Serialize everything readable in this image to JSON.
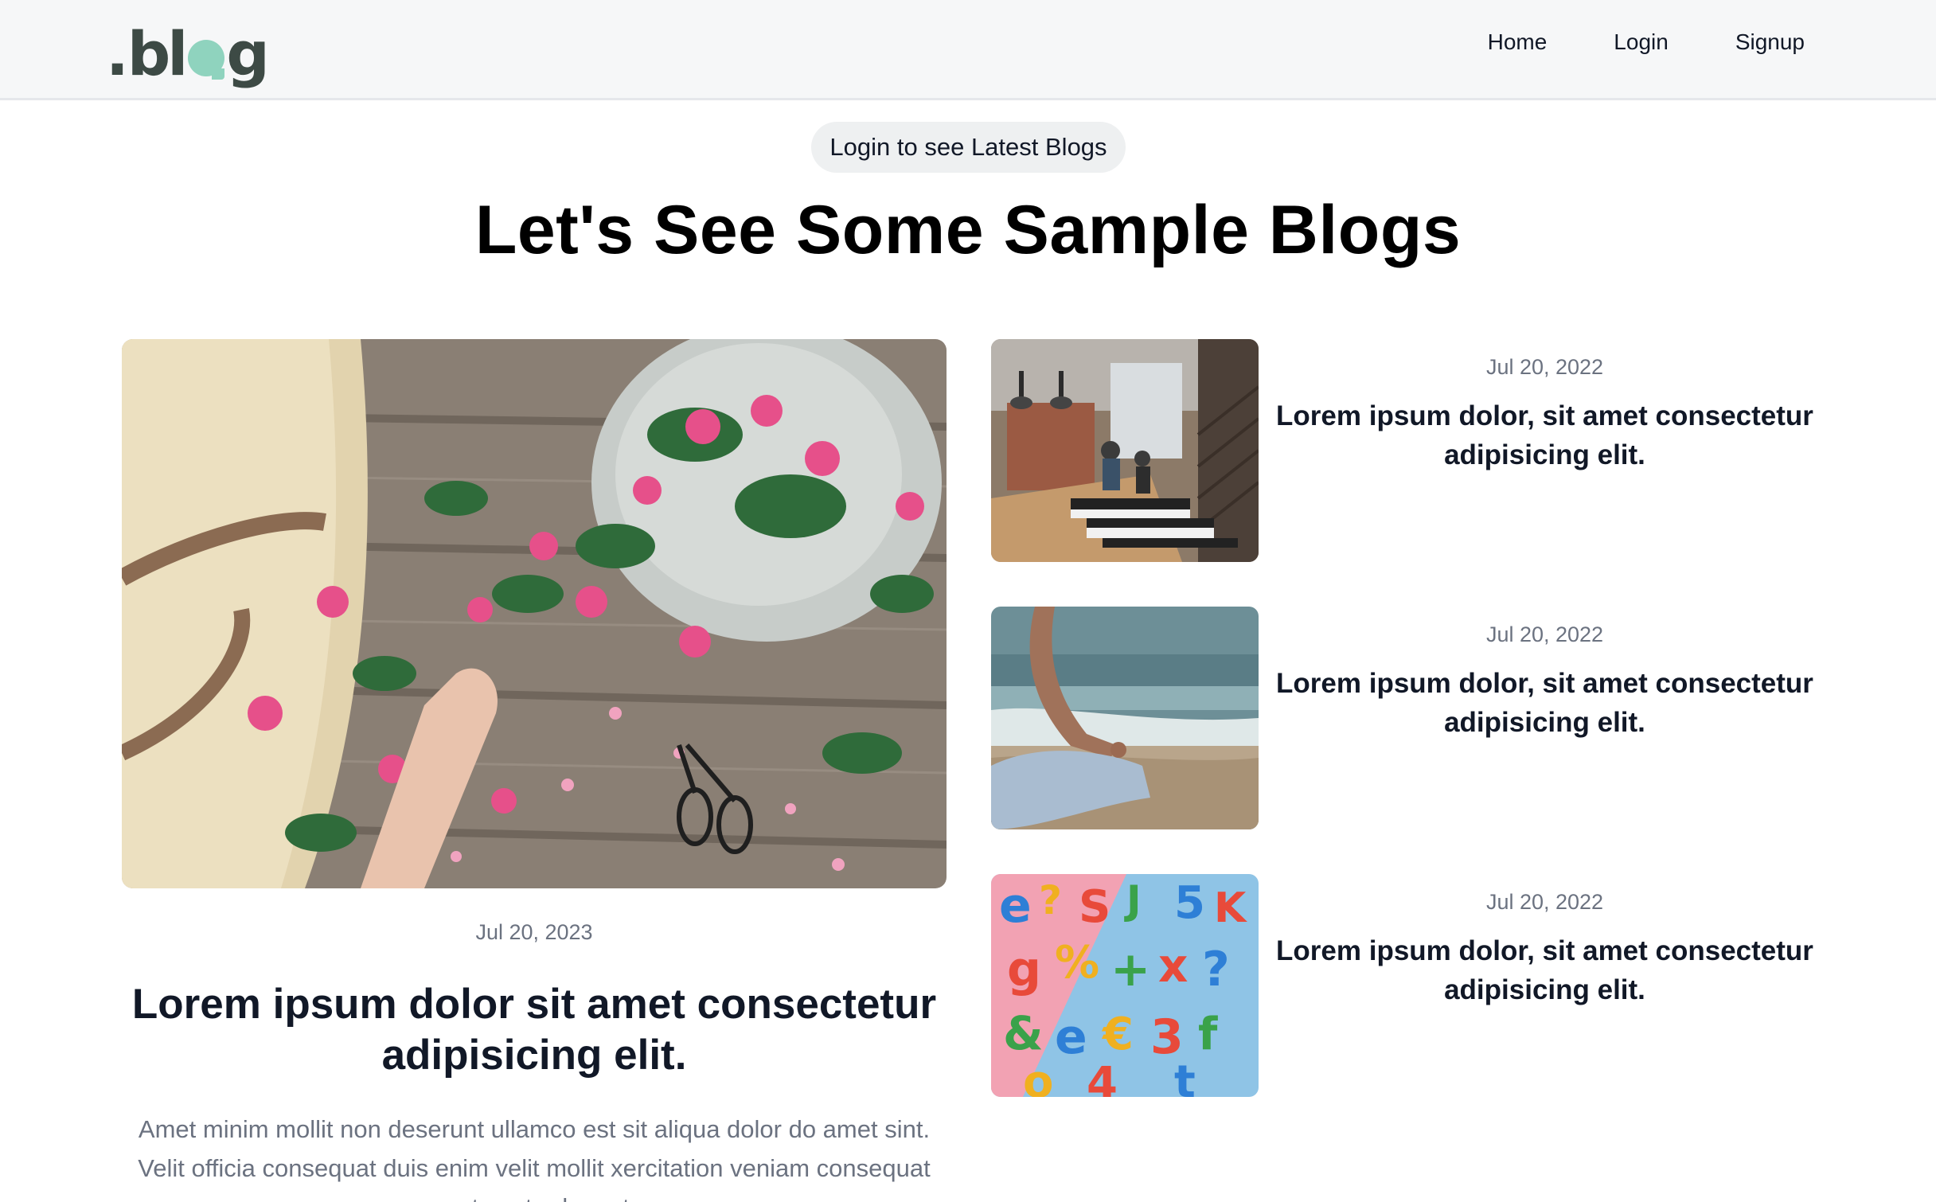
{
  "header": {
    "logo": {
      "dot": ".",
      "left": "bl",
      "right": "g"
    },
    "nav": [
      "Home",
      "Login",
      "Signup"
    ]
  },
  "hero": {
    "pill": "Login to see Latest Blogs",
    "title": "Let's See Some Sample Blogs"
  },
  "featured": {
    "date": "Jul 20, 2023",
    "title": "Lorem ipsum dolor sit amet consectetur adipisicing elit.",
    "excerpt": "Amet minim mollit non deserunt ullamco est sit aliqua dolor do amet sint. Velit officia consequat duis enim velit mollit xercitation veniam consequat sunt nostrud amet.",
    "image": "flowers-on-wood-image"
  },
  "posts": [
    {
      "date": "Jul 20, 2022",
      "title": "Lorem ipsum dolor, sit amet consectetur adipisicing elit.",
      "image": "office-interior-image"
    },
    {
      "date": "Jul 20, 2022",
      "title": "Lorem ipsum dolor, sit amet consectetur adipisicing elit.",
      "image": "beach-meditation-image"
    },
    {
      "date": "Jul 20, 2022",
      "title": "Lorem ipsum dolor, sit amet consectetur adipisicing elit.",
      "image": "colorful-letters-image"
    }
  ]
}
